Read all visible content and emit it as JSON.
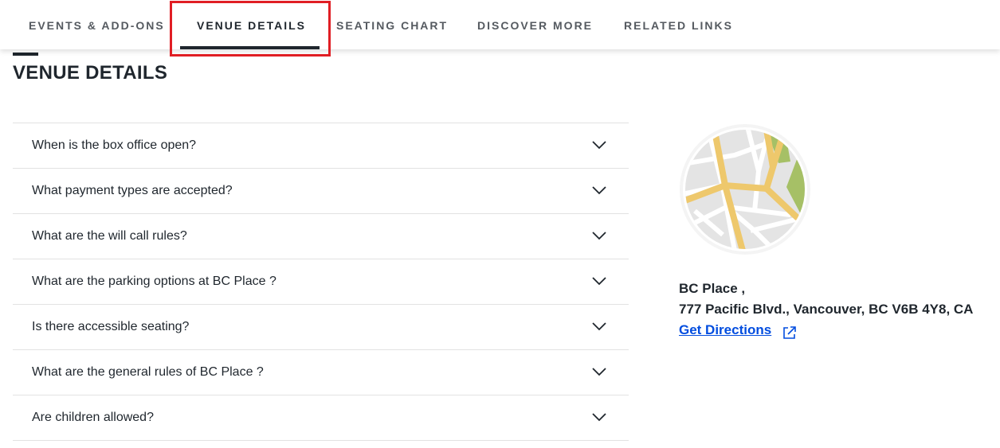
{
  "tabs": [
    {
      "label": "EVENTS & ADD-ONS"
    },
    {
      "label": "VENUE DETAILS"
    },
    {
      "label": "SEATING CHART"
    },
    {
      "label": "DISCOVER MORE"
    },
    {
      "label": "RELATED LINKS"
    }
  ],
  "active_tab": "VENUE DETAILS",
  "section": {
    "title": "VENUE DETAILS"
  },
  "faq": [
    {
      "question": "When is the box office open?"
    },
    {
      "question": "What payment types are accepted?"
    },
    {
      "question": "What are the will call rules?"
    },
    {
      "question": "What are the parking options at BC Place ?"
    },
    {
      "question": "Is there accessible seating?"
    },
    {
      "question": "What are the general rules of BC Place ?"
    },
    {
      "question": "Are children allowed?"
    }
  ],
  "venue": {
    "name": "BC Place ,",
    "address": "777 Pacific Blvd., Vancouver, BC V6B 4Y8, CA",
    "directions_label": "Get Directions"
  },
  "icons": {
    "chevron": "chevron-down-icon",
    "external": "external-link-icon",
    "map": "map-icon"
  },
  "colors": {
    "highlight": "#e01e24",
    "link": "#024ddf",
    "text": "#1f262d"
  }
}
